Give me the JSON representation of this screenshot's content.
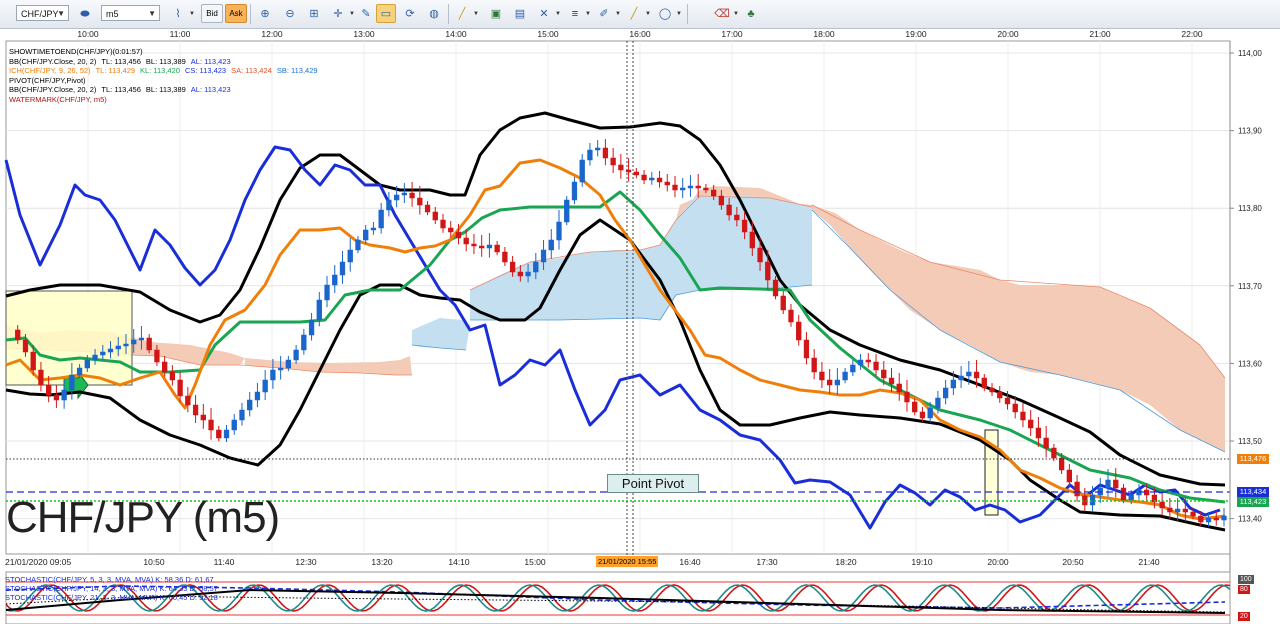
{
  "toolbar": {
    "symbol": "CHF/JPY",
    "timeframe": "m5",
    "bid_label": "Bid",
    "ask_label": "Ask"
  },
  "legend": [
    {
      "text": "SHOWTIMETOEND(CHF/JPY)(0:01:57)",
      "color": "#000000",
      "values": []
    },
    {
      "text": "BB(CHF/JPY.Close, 20, 2)",
      "color": "#000000",
      "values": [
        {
          "text": "TL: 113,456",
          "color": "#000000"
        },
        {
          "text": "BL: 113,389",
          "color": "#000000"
        },
        {
          "text": "AL: 113,423",
          "color": "#1a2ed8"
        }
      ]
    },
    {
      "text": "ICH(CHF/JPY, 9, 26, 52)",
      "color": "#f07f0a",
      "values": [
        {
          "text": "TL: 113,429",
          "color": "#f07f0a"
        },
        {
          "text": "KL: 113,420",
          "color": "#19a551"
        },
        {
          "text": "CS: 113,423",
          "color": "#1a2ed8"
        },
        {
          "text": "SA: 113,424",
          "color": "#e1522a"
        },
        {
          "text": "SB: 113,429",
          "color": "#1a6fd8"
        }
      ]
    },
    {
      "text": "PIVOT(CHF/JPY,Pivot)",
      "color": "#000000",
      "values": []
    },
    {
      "text": "BB(CHF/JPY.Close, 20, 2)",
      "color": "#000000",
      "values": [
        {
          "text": "TL: 113,456",
          "color": "#000000"
        },
        {
          "text": "BL: 113,389",
          "color": "#000000"
        },
        {
          "text": "AL: 113,423",
          "color": "#1a2ed8"
        }
      ]
    },
    {
      "text": "WATERMARK(CHF/JPY, m5)",
      "color": "#b01010",
      "values": []
    }
  ],
  "time_axis_top": [
    "10:00",
    "11:00",
    "12:00",
    "13:00",
    "14:00",
    "15:00",
    "16:00",
    "17:00",
    "18:00",
    "19:00",
    "20:00",
    "21:00",
    "22:00"
  ],
  "time_axis_bottom": [
    "21/01/2020 09:05",
    "10:50",
    "11:40",
    "12:30",
    "13:20",
    "14:10",
    "15:00",
    "16:40",
    "17:30",
    "18:20",
    "19:10",
    "20:00",
    "20:50",
    "21:40"
  ],
  "crosshair_time": "21/01/2020 15:55",
  "price_axis": [
    "114,00",
    "113,90",
    "113,80",
    "113,70",
    "113,60",
    "113,50",
    "113,40"
  ],
  "price_tags": [
    {
      "text": "113,476",
      "color": "#f07f0a"
    },
    {
      "text": "113,434",
      "color": "#1a2ed8"
    },
    {
      "text": "113,423",
      "color": "#19a551"
    }
  ],
  "watermark": "CHF/JPY (m5)",
  "pivot_label": "Point Pivot",
  "stochastic_legend": [
    "STOCHASTIC(CHF/JPY, 5, 3, 3, MVA, MVA)   K: 58,36   D: 61,67",
    "STOCHASTIC(CHF/JPY, 14, 3, 3, MVA, MVA)   K: 64,33   D: 58,57",
    "STOCHASTIC(CHF/JPY, 21, 3, 3, MVA, MVA)   K: 60,45   D: 52,18"
  ],
  "stochastic_levels": [
    "100",
    "80",
    "20"
  ],
  "colors": {
    "bull": "#1a66cc",
    "bear": "#d21616",
    "tenkan": "#f07f0a",
    "kijun": "#19a551",
    "chikou": "#1a2ed8",
    "bollinger": "#000000",
    "cloud_bull": "#c3dff0",
    "cloud_bear": "#f3cbb7"
  }
}
